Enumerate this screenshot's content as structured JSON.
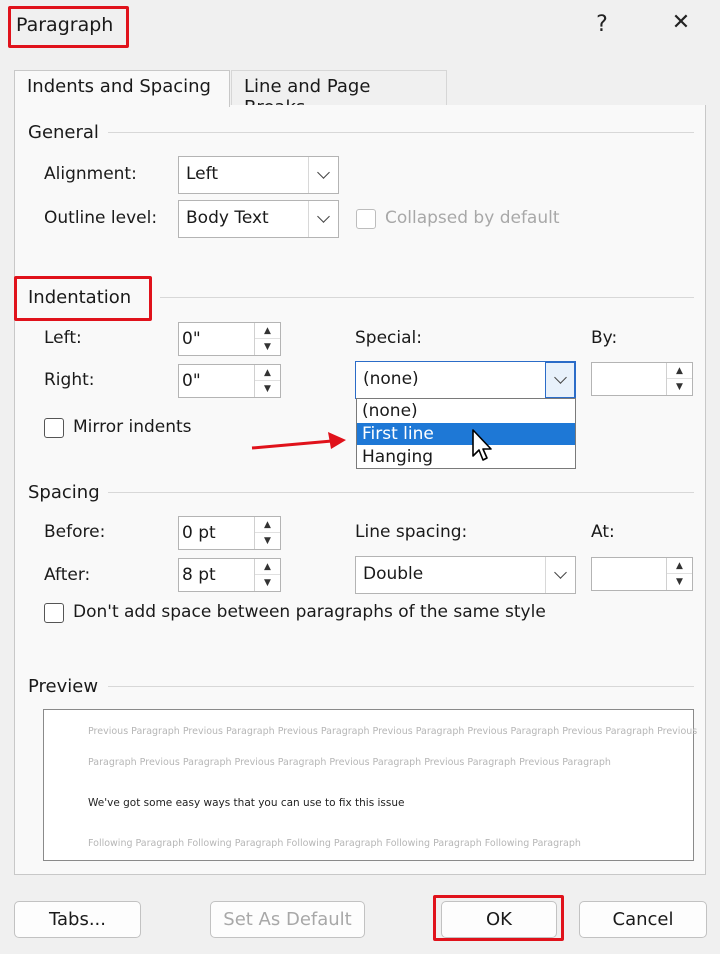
{
  "window": {
    "title": "Paragraph",
    "help": "?",
    "close": "✕"
  },
  "tabs": [
    {
      "label": "Indents and Spacing",
      "active": true
    },
    {
      "label": "Line and Page Breaks",
      "active": false
    }
  ],
  "general": {
    "heading": "General",
    "alignment_label": "Alignment:",
    "alignment_value": "Left",
    "outline_label": "Outline level:",
    "outline_value": "Body Text",
    "collapsed_label": "Collapsed by default"
  },
  "indentation": {
    "heading": "Indentation",
    "left_label": "Left:",
    "left_value": "0\"",
    "right_label": "Right:",
    "right_value": "0\"",
    "mirror_label": "Mirror indents",
    "special_label": "Special:",
    "special_value": "(none)",
    "special_options": [
      "(none)",
      "First line",
      "Hanging"
    ],
    "special_selected": "First line",
    "by_label": "By:",
    "by_value": ""
  },
  "spacing": {
    "heading": "Spacing",
    "before_label": "Before:",
    "before_value": "0 pt",
    "after_label": "After:",
    "after_value": "8 pt",
    "line_spacing_label": "Line spacing:",
    "line_spacing_value": "Double",
    "at_label": "At:",
    "at_value": "",
    "dont_add_label": "Don't add space between paragraphs of the same style"
  },
  "preview": {
    "heading": "Preview",
    "prev_line1": "Previous Paragraph Previous Paragraph Previous Paragraph Previous Paragraph Previous Paragraph Previous Paragraph Previous",
    "prev_line2": "Paragraph Previous Paragraph Previous Paragraph Previous Paragraph Previous Paragraph Previous Paragraph",
    "main_text": "We've got some easy ways that you can use to fix this issue",
    "follow_line": "Following Paragraph Following Paragraph Following Paragraph Following Paragraph Following Paragraph"
  },
  "buttons": {
    "tabs": "Tabs...",
    "set_default": "Set As Default",
    "ok": "OK",
    "cancel": "Cancel"
  },
  "colors": {
    "highlight": "#e0121b",
    "selection": "#1e78d6",
    "arrow": "#e0121b"
  }
}
